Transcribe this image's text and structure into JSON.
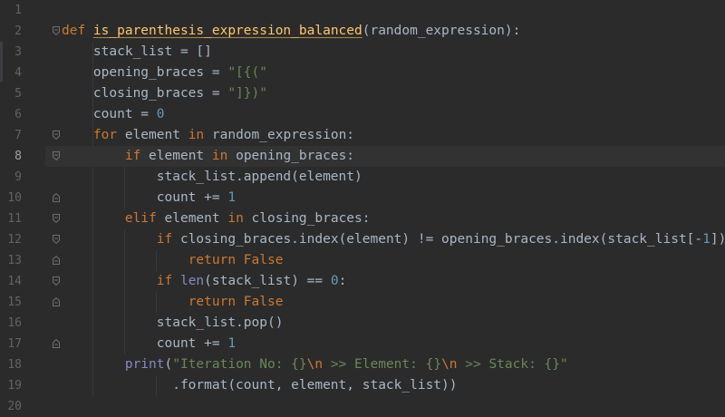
{
  "lines": [
    {
      "n": "1",
      "tokens": []
    },
    {
      "n": "2",
      "tokens": [
        {
          "c": "kw",
          "t": "def "
        },
        {
          "c": "fn",
          "t": "is_parenthesis_expression_balanced"
        },
        {
          "c": "plain",
          "t": "(random_expression):"
        }
      ]
    },
    {
      "n": "3",
      "tokens": [
        {
          "c": "plain",
          "t": "    stack_list = []"
        }
      ]
    },
    {
      "n": "4",
      "tokens": [
        {
          "c": "plain",
          "t": "    opening_braces = "
        },
        {
          "c": "str",
          "t": "\"[{(\""
        }
      ]
    },
    {
      "n": "5",
      "tokens": [
        {
          "c": "plain",
          "t": "    closing_braces = "
        },
        {
          "c": "str",
          "t": "\"]})\""
        }
      ]
    },
    {
      "n": "6",
      "tokens": [
        {
          "c": "plain",
          "t": "    count = "
        },
        {
          "c": "num",
          "t": "0"
        }
      ]
    },
    {
      "n": "7",
      "tokens": [
        {
          "c": "plain",
          "t": "    "
        },
        {
          "c": "kw",
          "t": "for "
        },
        {
          "c": "plain",
          "t": "element "
        },
        {
          "c": "kw",
          "t": "in "
        },
        {
          "c": "plain",
          "t": "random_expression:"
        }
      ]
    },
    {
      "n": "8",
      "tokens": [
        {
          "c": "plain",
          "t": "        "
        },
        {
          "c": "kw",
          "t": "if "
        },
        {
          "c": "plain",
          "t": "element "
        },
        {
          "c": "kw",
          "t": "in "
        },
        {
          "c": "plain",
          "t": "opening_braces:"
        }
      ]
    },
    {
      "n": "9",
      "tokens": [
        {
          "c": "plain",
          "t": "            stack_list.append(element)"
        }
      ]
    },
    {
      "n": "10",
      "tokens": [
        {
          "c": "plain",
          "t": "            count += "
        },
        {
          "c": "num",
          "t": "1"
        }
      ]
    },
    {
      "n": "11",
      "tokens": [
        {
          "c": "plain",
          "t": "        "
        },
        {
          "c": "kw",
          "t": "elif "
        },
        {
          "c": "plain",
          "t": "element "
        },
        {
          "c": "kw",
          "t": "in "
        },
        {
          "c": "plain",
          "t": "closing_braces:"
        }
      ]
    },
    {
      "n": "12",
      "tokens": [
        {
          "c": "plain",
          "t": "            "
        },
        {
          "c": "kw",
          "t": "if "
        },
        {
          "c": "plain",
          "t": "closing_braces.index(element) != opening_braces.index(stack_list[-"
        },
        {
          "c": "num",
          "t": "1"
        },
        {
          "c": "plain",
          "t": "]):"
        }
      ]
    },
    {
      "n": "13",
      "tokens": [
        {
          "c": "plain",
          "t": "                "
        },
        {
          "c": "kw",
          "t": "return False"
        }
      ]
    },
    {
      "n": "14",
      "tokens": [
        {
          "c": "plain",
          "t": "            "
        },
        {
          "c": "kw",
          "t": "if "
        },
        {
          "c": "bi",
          "t": "len"
        },
        {
          "c": "plain",
          "t": "(stack_list) == "
        },
        {
          "c": "num",
          "t": "0"
        },
        {
          "c": "plain",
          "t": ":"
        }
      ]
    },
    {
      "n": "15",
      "tokens": [
        {
          "c": "plain",
          "t": "                "
        },
        {
          "c": "kw",
          "t": "return False"
        }
      ]
    },
    {
      "n": "16",
      "tokens": [
        {
          "c": "plain",
          "t": "            stack_list.pop()"
        }
      ]
    },
    {
      "n": "17",
      "tokens": [
        {
          "c": "plain",
          "t": "            count += "
        },
        {
          "c": "num",
          "t": "1"
        }
      ]
    },
    {
      "n": "18",
      "tokens": [
        {
          "c": "plain",
          "t": "        "
        },
        {
          "c": "bi",
          "t": "print"
        },
        {
          "c": "plain",
          "t": "("
        },
        {
          "c": "str",
          "t": "\"Iteration No: {}"
        },
        {
          "c": "esc",
          "t": "\\n"
        },
        {
          "c": "str",
          "t": " >> Element: {}"
        },
        {
          "c": "esc",
          "t": "\\n"
        },
        {
          "c": "str",
          "t": " >> Stack: {}\""
        }
      ]
    },
    {
      "n": "19",
      "tokens": [
        {
          "c": "plain",
          "t": "              .format(count, element, stack_list))"
        }
      ]
    },
    {
      "n": "20",
      "tokens": []
    }
  ],
  "current_line": "8",
  "colors": {
    "background": "#2b2b2b",
    "keyword": "#cc7832",
    "function": "#ffc66d",
    "string": "#6a8759",
    "number": "#6897bb",
    "builtin": "#8888c6",
    "text": "#a9b7c6"
  },
  "fold_markers": {
    "open": [
      "2",
      "7",
      "8",
      "11",
      "12",
      "14"
    ],
    "close": [
      "10",
      "13",
      "15",
      "17"
    ]
  }
}
